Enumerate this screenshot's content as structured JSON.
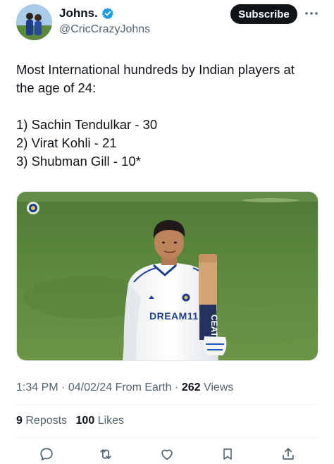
{
  "author": {
    "display_name": "Johns.",
    "handle": "@CricCrazyJohns",
    "verified": true
  },
  "header": {
    "subscribe_label": "Subscribe",
    "more_icon": "more-horizontal-icon"
  },
  "tweet": {
    "lines": [
      "Most International hundreds by Indian players at",
      "the age of 24:",
      "1) Sachin Tendulkar - 30",
      "2) Virat Kohli - 21",
      "3) Shubman Gill - 10*"
    ],
    "media_overlay_text": "DREAM11",
    "bat_sticker_text": "CEAT"
  },
  "meta": {
    "time": "1:34 PM",
    "date": "04/02/24",
    "source": "From Earth",
    "views_count": "262",
    "views_label": "Views"
  },
  "stats": {
    "reposts_count": "9",
    "reposts_label": "Reposts",
    "likes_count": "100",
    "likes_label": "Likes"
  },
  "actions": [
    "reply-icon",
    "repost-icon",
    "like-icon",
    "bookmark-icon",
    "share-icon"
  ],
  "colors": {
    "text_primary": "#0f1419",
    "text_secondary": "#536471",
    "verified_blue": "#1d9bf0",
    "action_icon": "#536471"
  }
}
